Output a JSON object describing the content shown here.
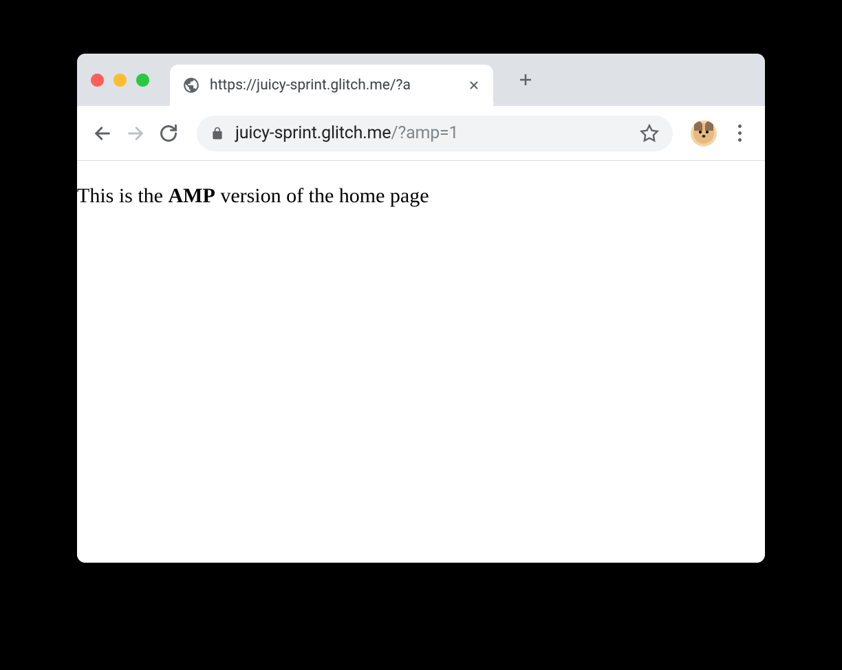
{
  "tab": {
    "title": "https://juicy-sprint.glitch.me/?a"
  },
  "addressBar": {
    "domain": "juicy-sprint.glitch.me",
    "query": "/?amp=1"
  },
  "page": {
    "text_prefix": "This is the ",
    "text_bold": "AMP",
    "text_suffix": " version of the home page"
  }
}
